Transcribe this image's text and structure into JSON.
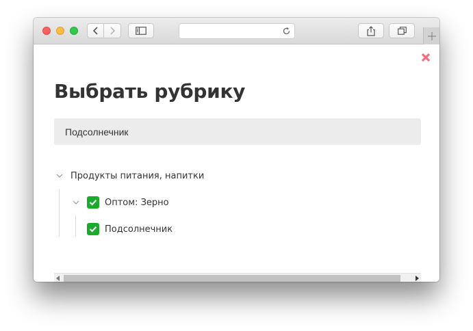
{
  "window": {
    "address_text": "",
    "toolbar": {
      "back_icon": "chevron-left-icon",
      "forward_icon": "chevron-right-icon",
      "sidebar_icon": "sidebar-icon",
      "reload_icon": "reload-icon",
      "share_icon": "share-icon",
      "tabs_icon": "tabs-icon",
      "newtab_icon": "plus-icon"
    }
  },
  "dialog": {
    "title": "Выбрать рубрику",
    "close_icon": "close-icon",
    "close_color": "#f46e7f",
    "search_value": "Подсолнечник"
  },
  "tree": [
    {
      "label": "Продукты питания, напитки",
      "expanded": true,
      "checked": false,
      "level": 0
    },
    {
      "label": "Оптом: Зерно",
      "expanded": true,
      "checked": true,
      "level": 1
    },
    {
      "label": "Подсолнечник",
      "expanded": false,
      "checked": true,
      "level": 2
    }
  ],
  "colors": {
    "checkbox": "#1aaa2c",
    "search_bg": "#ececec",
    "text": "#333333"
  }
}
